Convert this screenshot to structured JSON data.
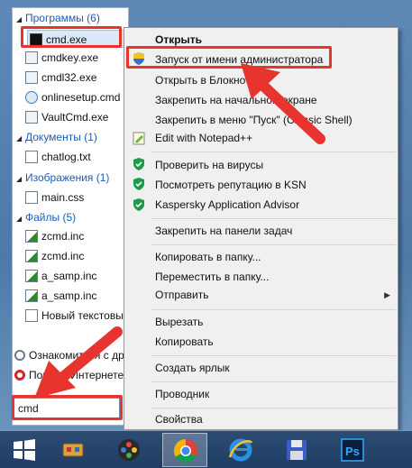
{
  "results": {
    "groups": [
      {
        "header": "Программы (6)",
        "items": [
          "cmd.exe",
          "cmdkey.exe",
          "cmdl32.exe",
          "onlinesetup.cmd",
          "VaultCmd.exe"
        ]
      },
      {
        "header": "Документы (1)",
        "items": [
          "chatlog.txt"
        ]
      },
      {
        "header": "Изображения (1)",
        "items": [
          "main.css"
        ]
      },
      {
        "header": "Файлы (5)",
        "items": [
          "zcmd.inc",
          "zcmd.inc",
          "a_samp.inc",
          "a_samp.inc",
          "Новый текстовый"
        ]
      }
    ],
    "aux_rows": [
      "Ознакомиться с др",
      "Поиск в Интернете"
    ]
  },
  "search": {
    "value": "cmd"
  },
  "context_menu": {
    "items": [
      "Открыть",
      "Запуск от имени администратора",
      "Открыть в Блокноте",
      "Закрепить на начальном экране",
      "Закрепить в меню \"Пуск\" (Classic Shell)",
      "Edit with Notepad++",
      "Проверить на вирусы",
      "Посмотреть репутацию в KSN",
      "Kaspersky Application Advisor",
      "Закрепить на панели задач",
      "Копировать в папку...",
      "Переместить в папку...",
      "Отправить",
      "Вырезать",
      "Копировать",
      "Создать ярлык",
      "Проводник",
      "Свойства"
    ]
  },
  "colors": {
    "highlight": "#e8342f",
    "group_header": "#1e5bb8",
    "kaspersky_green": "#1f9a4a"
  },
  "taskbar": {
    "icons": [
      "windows-start-icon",
      "game-icon",
      "paint-icon",
      "chrome-icon",
      "ie-icon",
      "floppy-icon",
      "photoshop-icon"
    ],
    "photoshop_label": "Ps"
  }
}
